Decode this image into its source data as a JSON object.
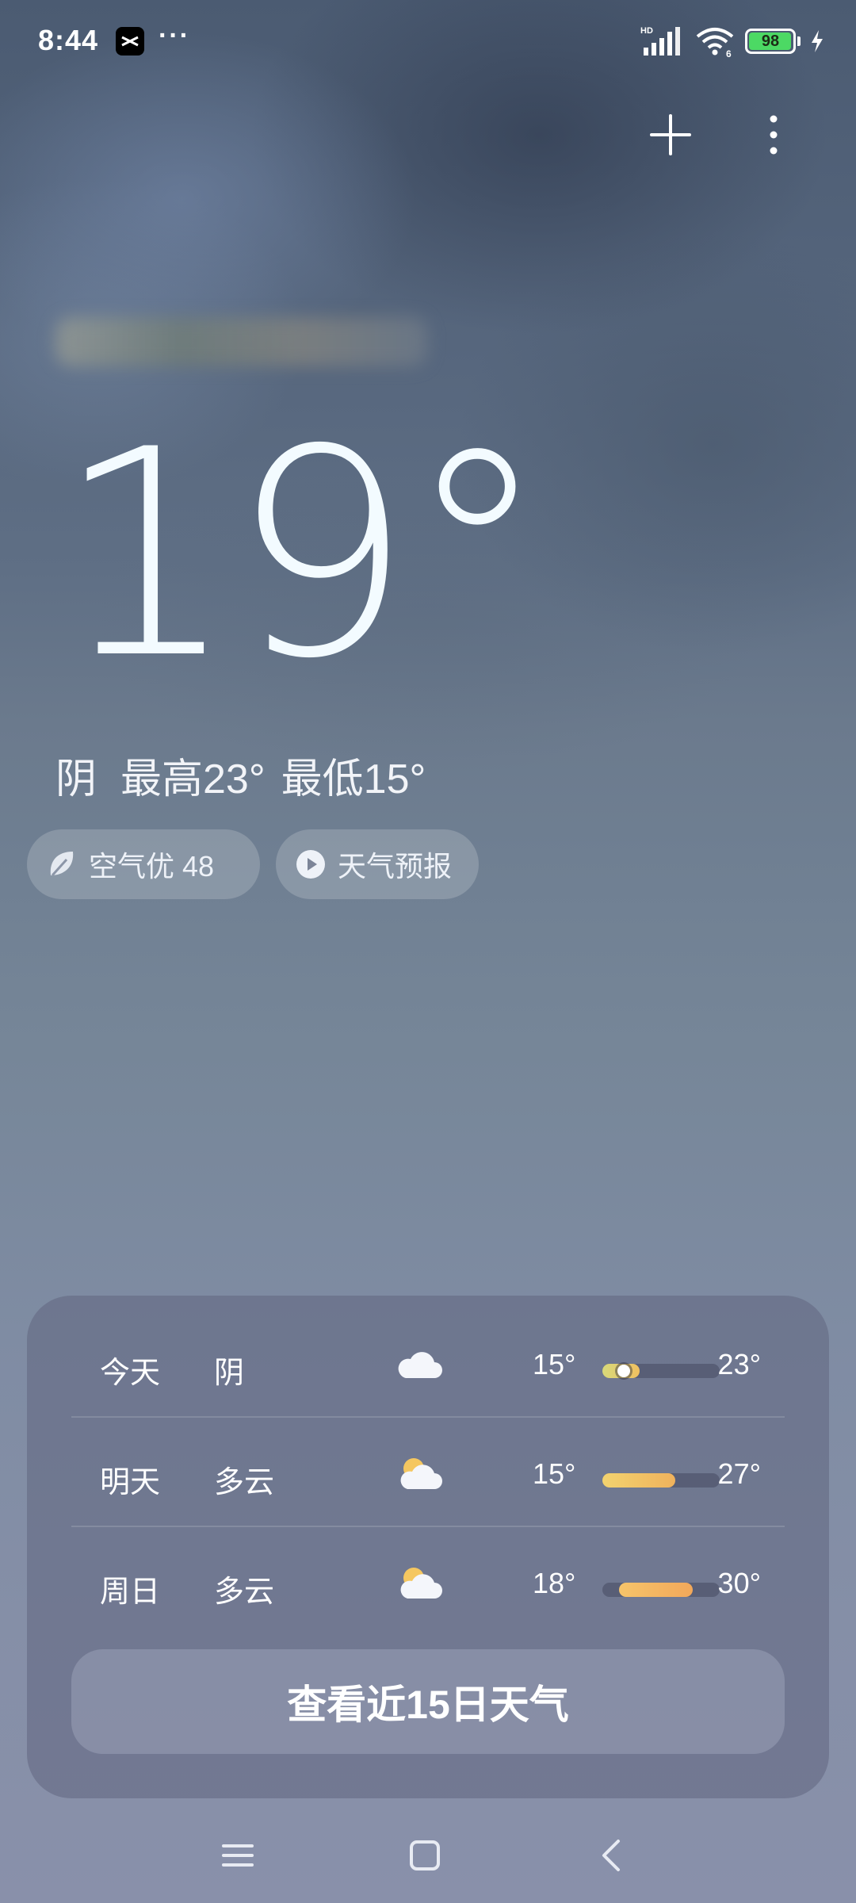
{
  "status_bar": {
    "time": "8:44",
    "more_dots": "···",
    "battery_level": "98",
    "battery_fill_percent": 98,
    "network_label": "HD",
    "wifi_label": "6"
  },
  "weather": {
    "current_temp": "19°",
    "condition": "阴",
    "high": "最高23°",
    "low": "最低15°",
    "air_quality_label": "空气优 48",
    "forecast_video_label": "天气预报"
  },
  "forecast": {
    "rows": [
      {
        "day": "今天",
        "condition": "阴",
        "icon": "cloud-icon",
        "low": "15°",
        "high": "23°",
        "bar_start": 0.0,
        "bar_end": 0.32,
        "now": 0.18,
        "bar_color_from": "#d8d97a",
        "bar_color_to": "#f0c060"
      },
      {
        "day": "明天",
        "condition": "多云",
        "icon": "partly-cloudy-icon",
        "low": "15°",
        "high": "27°",
        "bar_start": 0.0,
        "bar_end": 0.62,
        "now": null,
        "bar_color_from": "#f2d36f",
        "bar_color_to": "#f0b25c"
      },
      {
        "day": "周日",
        "condition": "多云",
        "icon": "partly-cloudy-icon",
        "low": "18°",
        "high": "30°",
        "bar_start": 0.14,
        "bar_end": 0.77,
        "now": null,
        "bar_color_from": "#f6c46a",
        "bar_color_to": "#f2a85a"
      }
    ],
    "cta_label": "查看近15日天气"
  },
  "colors": {
    "accent_yellow": "#f0c060",
    "card_bg": "#60667f",
    "battery_green": "#4cd964"
  }
}
